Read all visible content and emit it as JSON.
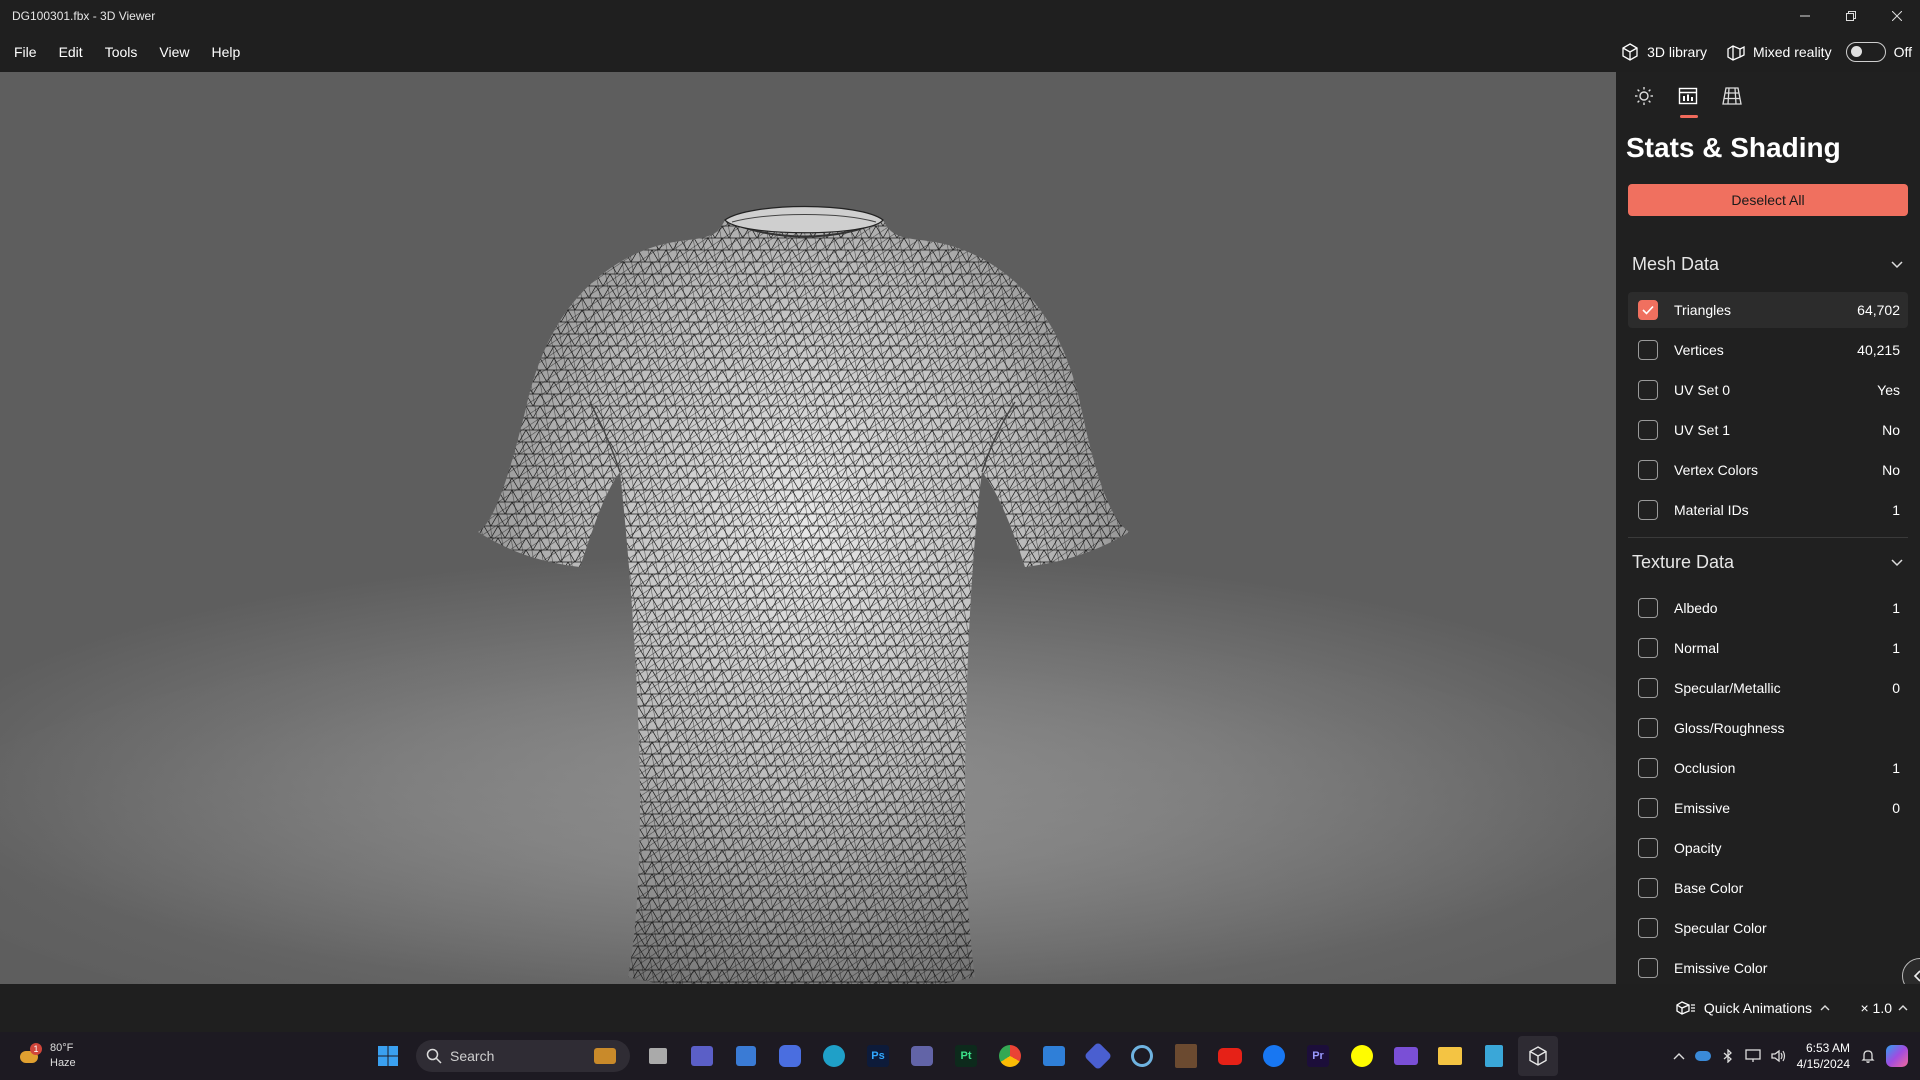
{
  "window": {
    "title": "DG100301.fbx - 3D Viewer"
  },
  "menu": [
    "File",
    "Edit",
    "Tools",
    "View",
    "Help"
  ],
  "toolbar": {
    "library_label": "3D library",
    "mixed_reality_label": "Mixed reality",
    "toggle_state": "Off"
  },
  "panel": {
    "title": "Stats & Shading",
    "deselect_label": "Deselect All",
    "mesh_section": "Mesh Data",
    "mesh_rows": [
      {
        "label": "Triangles",
        "value": "64,702",
        "checked": true
      },
      {
        "label": "Vertices",
        "value": "40,215",
        "checked": false
      },
      {
        "label": "UV Set 0",
        "value": "Yes",
        "checked": false
      },
      {
        "label": "UV Set 1",
        "value": "No",
        "checked": false
      },
      {
        "label": "Vertex Colors",
        "value": "No",
        "checked": false
      },
      {
        "label": "Material IDs",
        "value": "1",
        "checked": false
      }
    ],
    "texture_section": "Texture Data",
    "texture_rows": [
      {
        "label": "Albedo",
        "value": "1"
      },
      {
        "label": "Normal",
        "value": "1"
      },
      {
        "label": "Specular/Metallic",
        "value": "0"
      },
      {
        "label": "Gloss/Roughness",
        "value": ""
      },
      {
        "label": "Occlusion",
        "value": "1"
      },
      {
        "label": "Emissive",
        "value": "0"
      },
      {
        "label": "Opacity",
        "value": ""
      },
      {
        "label": "Base Color",
        "value": ""
      },
      {
        "label": "Specular Color",
        "value": ""
      },
      {
        "label": "Emissive Color",
        "value": ""
      }
    ]
  },
  "bottom": {
    "animations_label": "Quick Animations",
    "speed": "× 1.0"
  },
  "taskbar": {
    "weather_temp": "80°F",
    "weather_desc": "Haze",
    "weather_badge": "1",
    "search_placeholder": "Search",
    "time": "6:53 AM",
    "date": "4/15/2024"
  },
  "colors": {
    "accent": "#f0705f",
    "panel_bg": "#202020",
    "titlebar_bg": "#1f1f1f"
  }
}
